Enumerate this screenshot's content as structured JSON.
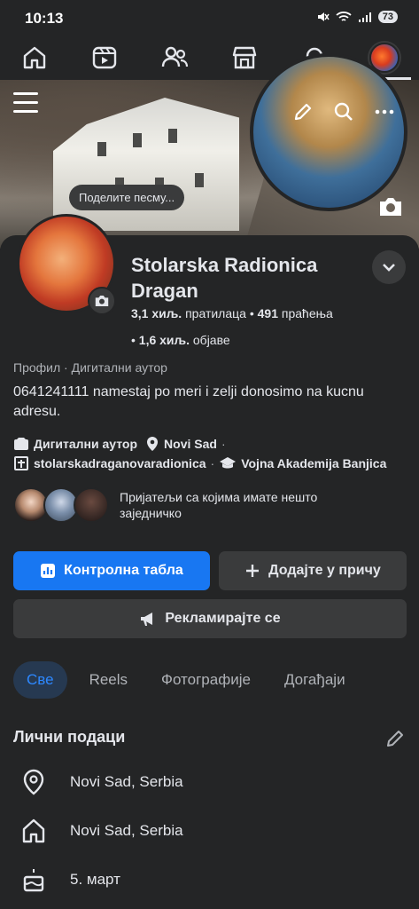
{
  "status_bar": {
    "time": "10:13",
    "battery": "73"
  },
  "nav": {
    "items": [
      {
        "name": "home",
        "icon": "home-icon"
      },
      {
        "name": "reels",
        "icon": "video-icon"
      },
      {
        "name": "friends",
        "icon": "friends-icon"
      },
      {
        "name": "marketplace",
        "icon": "store-icon"
      },
      {
        "name": "notifications",
        "icon": "bell-icon"
      },
      {
        "name": "profile",
        "icon": "avatar"
      }
    ],
    "active": "profile"
  },
  "cover": {
    "tooltip": "Поделите песму..."
  },
  "profile": {
    "name": "Stolarska Radionica Dragan",
    "followers_count": "3,1 хиљ.",
    "followers_label": "пратилаца",
    "following_count": "491",
    "following_label": "праћења",
    "posts_count": "1,6 хиљ.",
    "posts_label": "објаве",
    "category": "Профил · Дигитални аутор",
    "bio": "0641241111 namestaj po meri i zelji donosimo na kucnu adresu.",
    "detail_creator": "Дигитални аутор",
    "detail_city": "Novi Sad",
    "detail_instagram": "stolarskadraganovaradionica",
    "detail_school": "Vojna Akademija Banjica",
    "mutual_text": "Пријатељи са којима имате нешто заједничко"
  },
  "actions": {
    "dashboard": "Контролна табла",
    "add_story": "Додајте у причу",
    "advertise": "Рекламирајте се"
  },
  "tabs": {
    "all": "Све",
    "reels": "Reels",
    "photos": "Фотографије",
    "events": "Догађаји"
  },
  "personal_info": {
    "title": "Лични подаци",
    "location": "Novi Sad, Serbia",
    "hometown": "Novi Sad, Serbia",
    "birthday": "5. март"
  },
  "colors": {
    "background": "#242526",
    "primary": "#1877f2",
    "secondary_button": "#3a3b3c",
    "active_tab_bg": "#263951",
    "active_tab_text": "#2d88ff"
  }
}
